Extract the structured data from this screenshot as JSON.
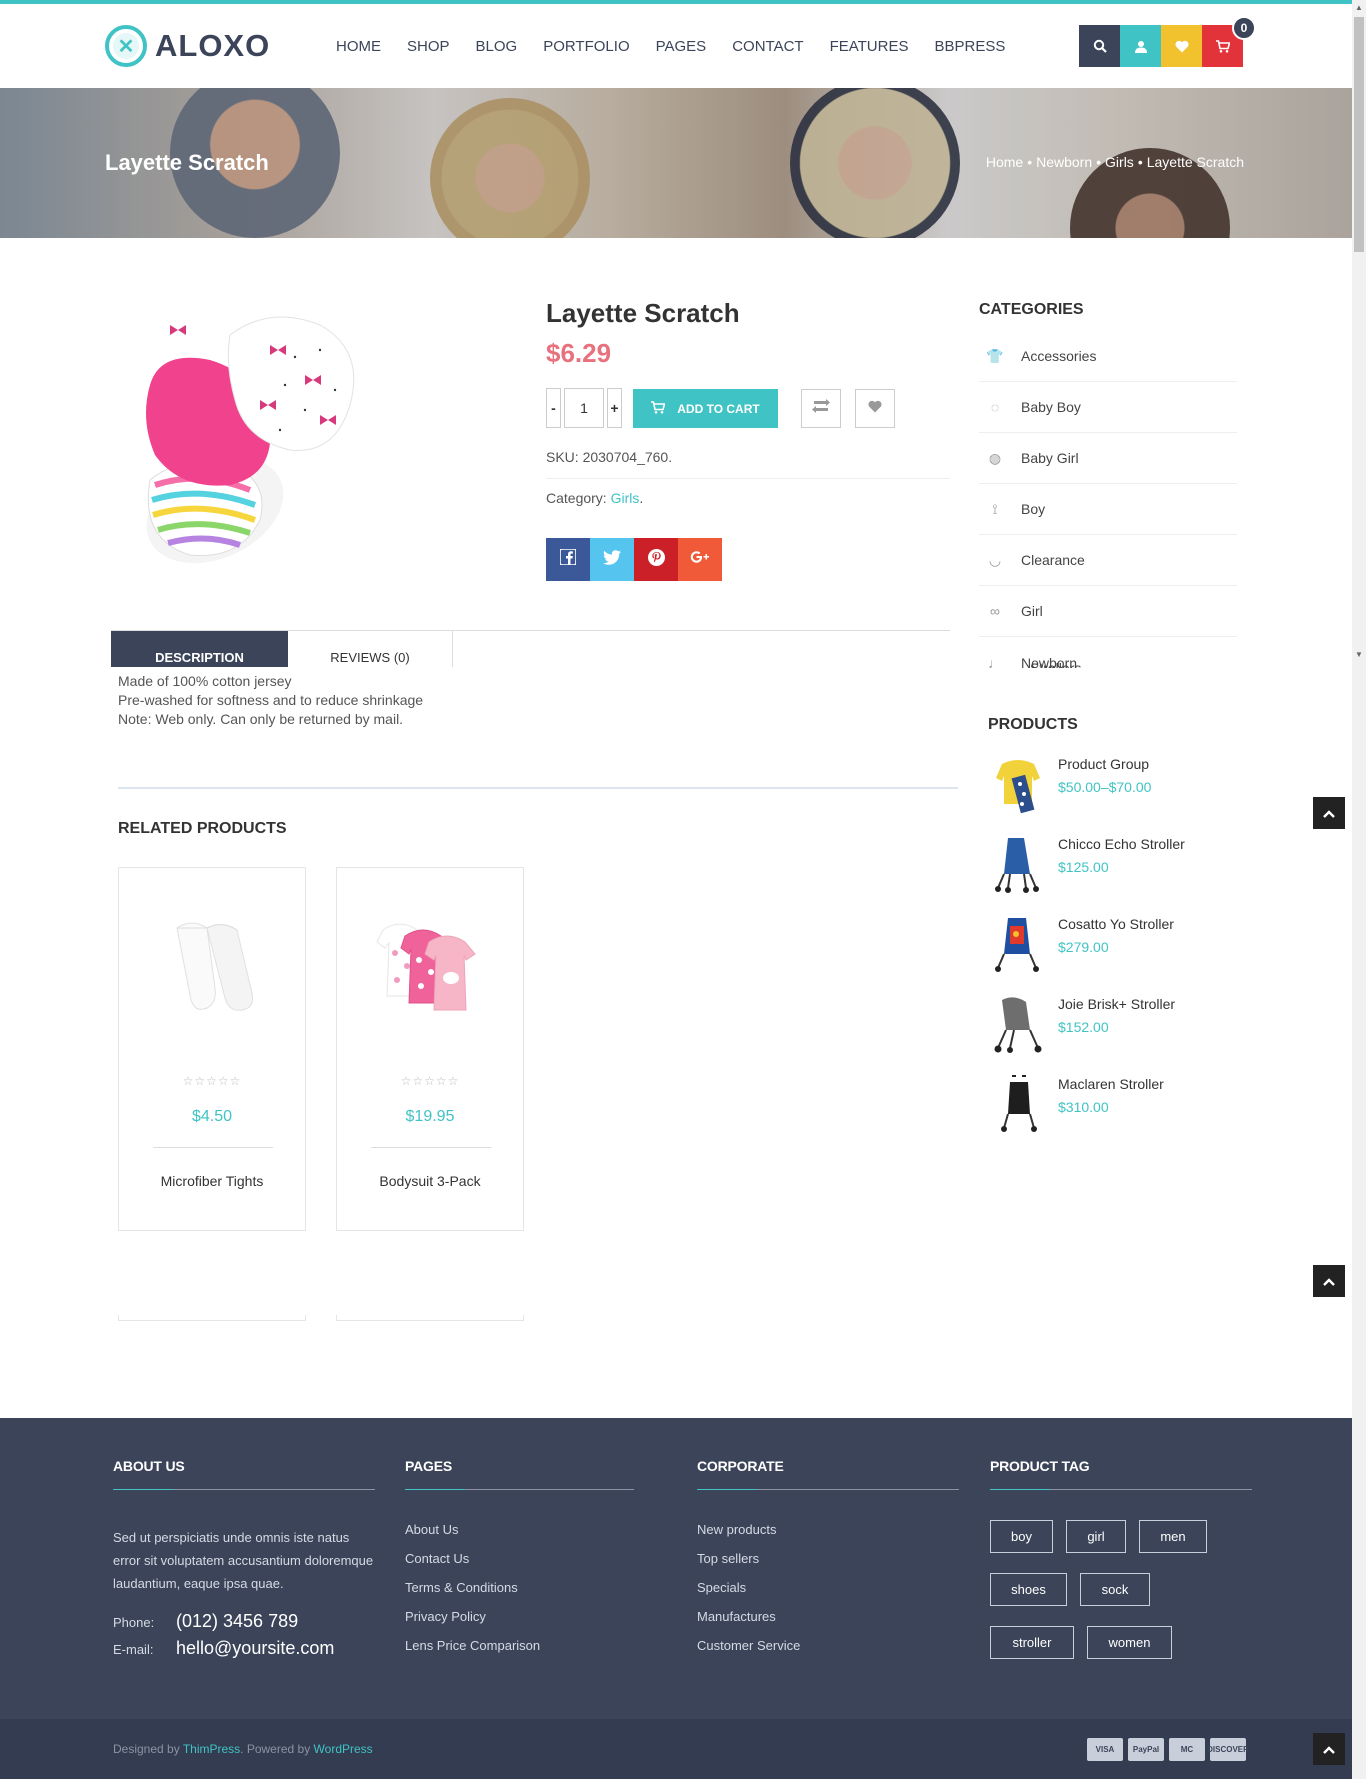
{
  "brand": {
    "name": "ALOXO",
    "accent": "#40c3c4",
    "dark": "#3b4459"
  },
  "nav": [
    "HOME",
    "SHOP",
    "BLOG",
    "PORTFOLIO",
    "PAGES",
    "CONTACT",
    "FEATURES",
    "BBPRESS"
  ],
  "header_icons": {
    "search": "search-icon",
    "user": "user-icon",
    "wishlist": "heart-icon",
    "cart": "cart-icon",
    "cart_count": "0"
  },
  "banner": {
    "title": "Layette Scratch",
    "breadcrumb": [
      "Home",
      "•",
      "Newborn",
      "•",
      "Girls",
      "•",
      "Layette Scratch"
    ]
  },
  "product": {
    "title": "Layette Scratch",
    "price": "$6.29",
    "qty": "1",
    "minus": "-",
    "plus": "+",
    "add_to_cart": "ADD TO CART",
    "sku": "SKU: 2030704_760.",
    "category_label": "Category: ",
    "category": "Girls",
    "category_suffix": "."
  },
  "tabs": {
    "description": "DESCRIPTION",
    "reviews": "REVIEWS (0)"
  },
  "description": [
    "Made of 100% cotton jersey",
    "Pre-washed for softness and to reduce shrinkage",
    "Note: Web only. Can only be returned by mail."
  ],
  "related": {
    "heading": "RELATED PRODUCTS",
    "items": [
      {
        "name": "Microfiber Tights",
        "price": "$4.50",
        "stars": "☆☆☆☆☆"
      },
      {
        "name": "Bodysuit 3-Pack",
        "price": "$19.95",
        "stars": "☆☆☆☆☆"
      }
    ]
  },
  "sidebar": {
    "categories_heading": "CATEGORIES",
    "categories": [
      "Accessories",
      "Baby Boy",
      "Baby Girl",
      "Boy",
      "Clearance",
      "Girl",
      "Newborn"
    ],
    "categories_peek": "Strollers",
    "products_heading": "PRODUCTS",
    "products": [
      {
        "name": "Product Group",
        "price": "$50.00–$70.00"
      },
      {
        "name": "Chicco Echo Stroller",
        "price": "$125.00"
      },
      {
        "name": "Cosatto Yo Stroller",
        "price": "$279.00"
      },
      {
        "name": "Joie Brisk+ Stroller",
        "price": "$152.00"
      },
      {
        "name": "Maclaren Stroller",
        "price": "$310.00"
      }
    ]
  },
  "footer": {
    "about": {
      "heading": "ABOUT US",
      "text": "Sed ut perspiciatis unde omnis iste natus error sit voluptatem accusantium doloremque laudantium, eaque ipsa quae.",
      "phone_label": "Phone:",
      "phone": "(012) 3456 789",
      "email_label": "E-mail:",
      "email": "hello@yoursite.com"
    },
    "pages": {
      "heading": "PAGES",
      "links": [
        "About Us",
        "Contact Us",
        "Terms & Conditions",
        "Privacy Policy",
        "Lens Price Comparison"
      ]
    },
    "corporate": {
      "heading": "CORPORATE",
      "links": [
        "New products",
        "Top sellers",
        "Specials",
        "Manufactures",
        "Customer Service"
      ]
    },
    "tags": {
      "heading": "PRODUCT TAG",
      "items": [
        "boy",
        "girl",
        "men",
        "shoes",
        "sock",
        "stroller",
        "women"
      ]
    },
    "credits": {
      "designed_by": "Designed by ",
      "thimpress": "ThimPress",
      "powered_by": ". Powered by ",
      "wordpress": "WordPress"
    },
    "payments": [
      "VISA",
      "PayPal",
      "MC",
      "DISCOVER"
    ]
  }
}
